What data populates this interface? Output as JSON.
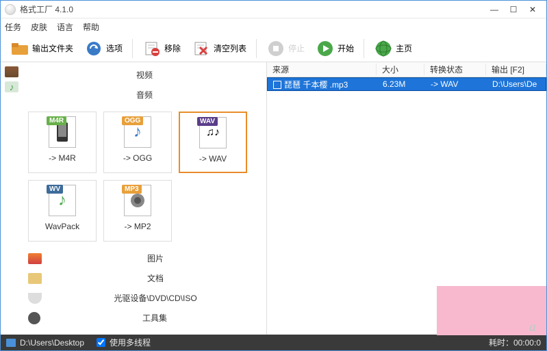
{
  "window": {
    "title": "格式工厂 4.1.0"
  },
  "menu": {
    "task": "任务",
    "skin": "皮肤",
    "language": "语言",
    "help": "帮助"
  },
  "toolbar": {
    "output_folder": "输出文件夹",
    "options": "选项",
    "remove": "移除",
    "clear_list": "清空列表",
    "stop": "停止",
    "start": "开始",
    "home": "主页"
  },
  "sections": {
    "video": "视频",
    "audio": "音频",
    "picture": "图片",
    "document": "文档",
    "disc": "光驱设备\\DVD\\CD\\ISO",
    "tools": "工具集"
  },
  "formats": {
    "m4r": {
      "badge": "M4R",
      "label": "-> M4R",
      "badge_color": "#67b04a"
    },
    "ogg": {
      "badge": "OGG",
      "label": "-> OGG",
      "badge_color": "#e8a03a"
    },
    "wav": {
      "badge": "WAV",
      "label": "-> WAV",
      "badge_color": "#5a3d8a"
    },
    "wavpack": {
      "badge": "WV",
      "label": "WavPack",
      "badge_color": "#3d6b9a"
    },
    "mp2": {
      "badge": "MP3",
      "label": "-> MP2",
      "badge_color": "#e8a03a"
    }
  },
  "list": {
    "headers": {
      "source": "来源",
      "size": "大小",
      "state": "转换状态",
      "output": "输出 [F2]"
    },
    "rows": [
      {
        "source": "琵琶 千本樱  .mp3",
        "size": "6.23M",
        "state": "-> WAV",
        "output": "D:\\Users\\De"
      }
    ]
  },
  "status": {
    "path": "D:\\Users\\Desktop",
    "multithread": "使用多线程",
    "elapsed_label": "耗时：",
    "elapsed_value": "00:00:0"
  }
}
